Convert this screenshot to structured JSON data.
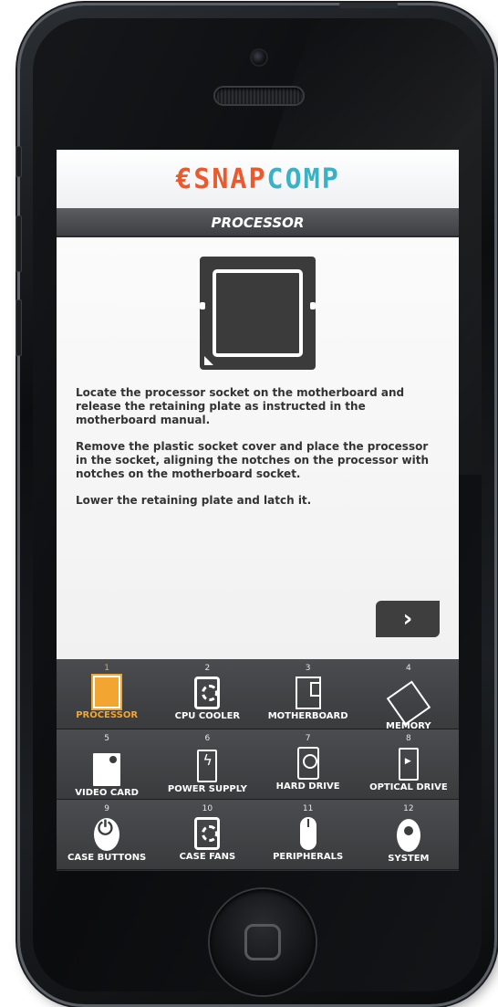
{
  "app": {
    "logo_part1": "€SNAP",
    "logo_part2": "COMP",
    "title": "PROCESSOR"
  },
  "content": {
    "paragraphs": [
      "Locate the processor socket on the motherboard and release the retaining plate as instructed in the motherboard manual.",
      "Remove the plastic socket cover and place the processor in the socket, aligning the notches on the processor with notches on the motherboard socket.",
      "Lower the retaining plate and latch it."
    ],
    "next_icon": "chevron-right-icon",
    "next_glyph": "›"
  },
  "nav": {
    "items": [
      {
        "num": "1",
        "label": "PROCESSOR",
        "icon": "processor-icon",
        "active": true
      },
      {
        "num": "2",
        "label": "CPU COOLER",
        "icon": "cpu-cooler-icon"
      },
      {
        "num": "3",
        "label": "MOTHERBOARD",
        "icon": "motherboard-icon"
      },
      {
        "num": "4",
        "label": "MEMORY",
        "icon": "memory-icon"
      },
      {
        "num": "5",
        "label": "VIDEO CARD",
        "icon": "video-card-icon"
      },
      {
        "num": "6",
        "label": "POWER SUPPLY",
        "icon": "power-supply-icon"
      },
      {
        "num": "7",
        "label": "HARD DRIVE",
        "icon": "hard-drive-icon"
      },
      {
        "num": "8",
        "label": "OPTICAL DRIVE",
        "icon": "optical-drive-icon"
      },
      {
        "num": "9",
        "label": "CASE BUTTONS",
        "icon": "power-button-icon"
      },
      {
        "num": "10",
        "label": "CASE FANS",
        "icon": "case-fan-icon"
      },
      {
        "num": "11",
        "label": "PERIPHERALS",
        "icon": "mouse-icon"
      },
      {
        "num": "12",
        "label": "SYSTEM",
        "icon": "disc-icon"
      }
    ]
  },
  "colors": {
    "accent": "#f3a531",
    "logo_orange": "#ea5a2c",
    "logo_teal": "#3ab1c4",
    "bar": "#3e3e3e"
  }
}
